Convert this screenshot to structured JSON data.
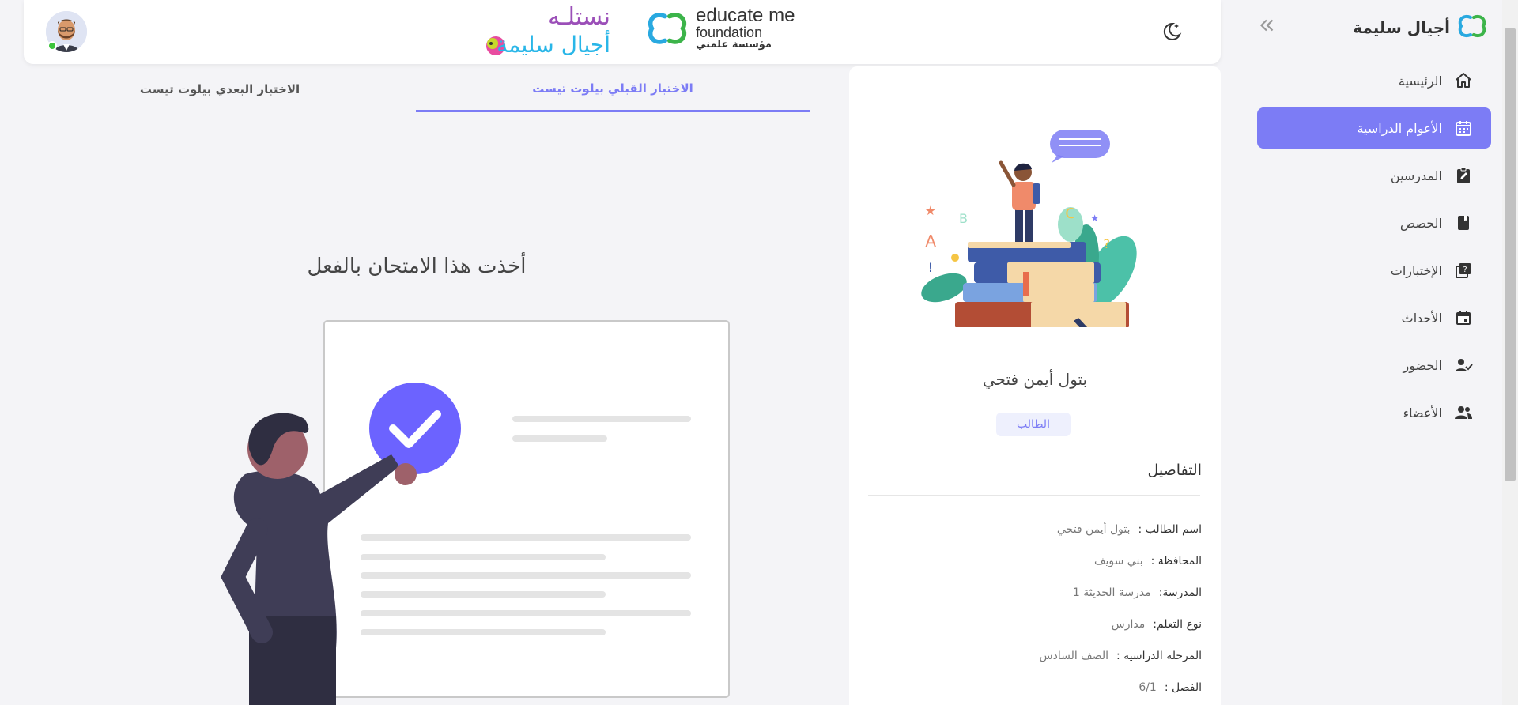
{
  "sidebar": {
    "brand_name": "أجيال سليمة",
    "collapse_icon": "chevrons-left-icon",
    "items": [
      {
        "label": "الرئيسية",
        "icon": "home-icon",
        "active": false
      },
      {
        "label": "الأعوام الدراسية",
        "icon": "calendar-grid-icon",
        "active": true
      },
      {
        "label": "المدرسين",
        "icon": "clipboard-edit-icon",
        "active": false
      },
      {
        "label": "الحصص",
        "icon": "book-icon",
        "active": false
      },
      {
        "label": "الإختبارات",
        "icon": "quiz-icon",
        "active": false
      },
      {
        "label": "الأحداث",
        "icon": "event-icon",
        "active": false
      },
      {
        "label": "الحضور",
        "icon": "user-check-icon",
        "active": false
      },
      {
        "label": "الأعضاء",
        "icon": "users-icon",
        "active": false
      }
    ]
  },
  "header": {
    "theme_icon": "moon-stars-icon",
    "logo_educate": {
      "line1": "educate me",
      "line2": "foundation",
      "line3": "مؤسسة علمني"
    },
    "logo_ajyal": {
      "line1": "نستلـه",
      "line2": "أجيال سليمة"
    }
  },
  "profile": {
    "name": "بتول أيمن فتحي",
    "role": "الطالب",
    "details_title": "التفاصيل",
    "details": [
      {
        "label": "اسم الطالب :",
        "value": "بتول أيمن فتحي"
      },
      {
        "label": "المحافظة :",
        "value": "بني سويف"
      },
      {
        "label": "المدرسة:",
        "value": "مدرسة الحديثة 1"
      },
      {
        "label": "نوع التعلم:",
        "value": "مدارس"
      },
      {
        "label": "المرحلة الدراسية :",
        "value": "الصف السادس"
      },
      {
        "label": "الفصل :",
        "value": "6/1"
      }
    ]
  },
  "tabs": {
    "pre": "الاختبار القبلي بيلوت تيست",
    "post": "الاختبار البعدي بيلوت تيست"
  },
  "main": {
    "message": "أخذت هذا الامتحان بالفعل"
  },
  "colors": {
    "accent": "#7c7cf5",
    "background": "#f4f4f7"
  }
}
